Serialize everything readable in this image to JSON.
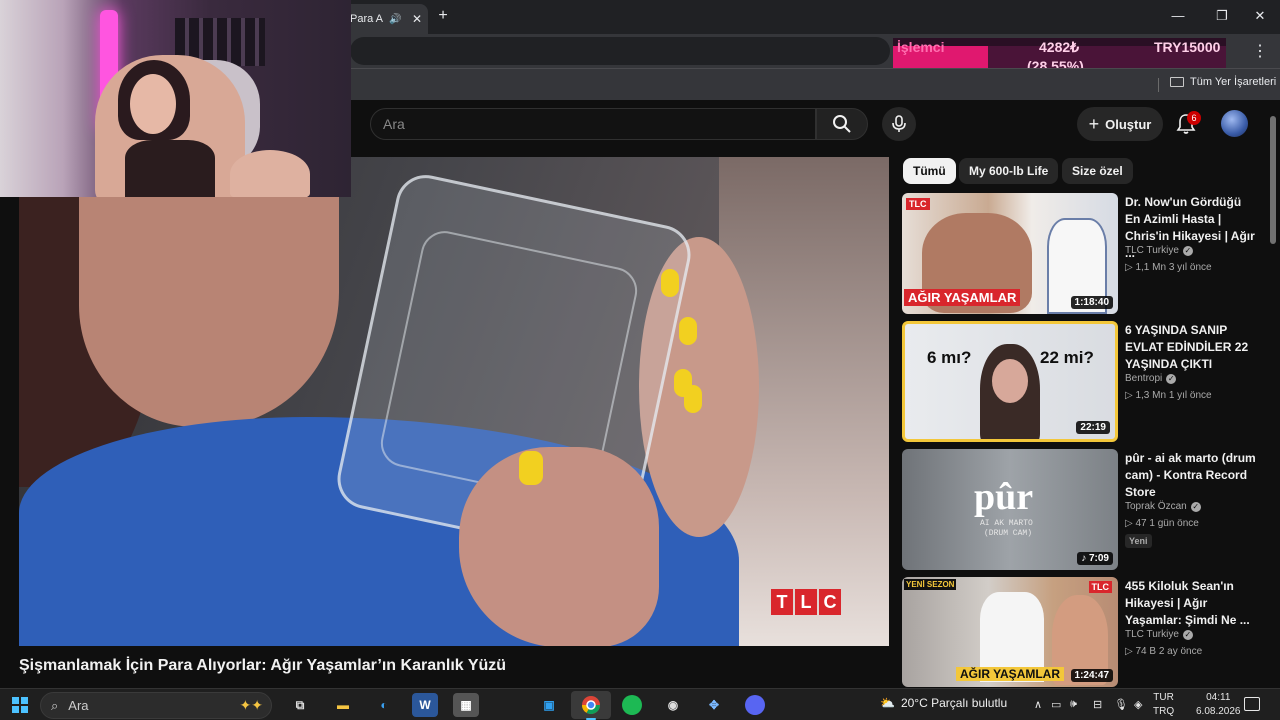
{
  "browser": {
    "tab_title": "Para A",
    "new_tab_symbol": "+",
    "window_controls": {
      "minimize": "—",
      "maximize": "❐",
      "close": "✕"
    },
    "menu": "⋮",
    "bookmarks_folder": "Tüm Yer İşaretleri"
  },
  "cpu_overlay": {
    "label": "İşlemci",
    "value": "4282₺",
    "percent": "(28.55%)",
    "target": "TRY15000",
    "fill_fraction": 0.2855
  },
  "header": {
    "search_placeholder": "Ara",
    "create_label": "Oluştur",
    "notifications_count": "6"
  },
  "video": {
    "title": "Şişmanlamak İçin Para Alıyorlar: Ağır Yaşamlar’ın Karanlık Yüzü",
    "watermark": "TLC"
  },
  "chips": [
    {
      "label": "Tümü",
      "active": true
    },
    {
      "label": "My 600-lb Life",
      "active": false
    },
    {
      "label": "Size özel",
      "active": false
    }
  ],
  "recommendations": [
    {
      "title": "Dr. Now'un Gördüğü En Azimli Hasta | Chris'in Hikayesi | Ağır ...",
      "channel": "TLC Turkiye",
      "meta": "▷ 1,1 Mn   3 yıl önce",
      "duration": "1:18:40",
      "thumb_text": "AĞIR YAŞAMLAR",
      "thumb_logo": "TLC"
    },
    {
      "title": "6 YAŞINDA SANIP EVLAT EDİNDİLER 22 YAŞINDA ÇIKTI",
      "channel": "Bentropi",
      "meta": "▷ 1,3 Mn   1 yıl önce",
      "duration": "22:19",
      "thumb_left": "6 mı?",
      "thumb_right": "22 mi?"
    },
    {
      "title": "pûr - ai ak marto (drum cam) - Kontra Record Store",
      "channel": "Toprak Özcan",
      "meta": "▷ 47   1 gün önce",
      "duration": "♪ 7:09",
      "badge": "Yeni",
      "thumb_big": "pûr",
      "thumb_sub": "AI AK MARTO",
      "thumb_sub2": "(DRUM CAM)"
    },
    {
      "title": "455 Kiloluk Sean'ın Hikayesi | Ağır Yaşamlar: Şimdi Ne ...",
      "channel": "TLC Turkiye",
      "meta": "▷ 74 B   2 ay önce",
      "duration": "1:24:47",
      "thumb_top": "YENİ SEZON",
      "thumb_text": "AĞIR YAŞAMLAR",
      "thumb_logo": "TLC"
    }
  ],
  "taskbar": {
    "search_placeholder": "Ara",
    "apps": [
      "task-view",
      "file-explorer",
      "edge",
      "word",
      "calculator",
      "store",
      "chrome",
      "spotify",
      "obs",
      "snipping",
      "discord"
    ],
    "weather": "20°C  Parçalı bulutlu",
    "lang_top": "TUR",
    "lang_bottom": "TRQ",
    "time": "04:11",
    "date": "6.08.2026"
  },
  "colors": {
    "accent_red": "#cc0000",
    "cpu_pink": "#e0186f",
    "thumb_highlight": "#f3c73a",
    "nail_yellow": "#f2d020"
  }
}
